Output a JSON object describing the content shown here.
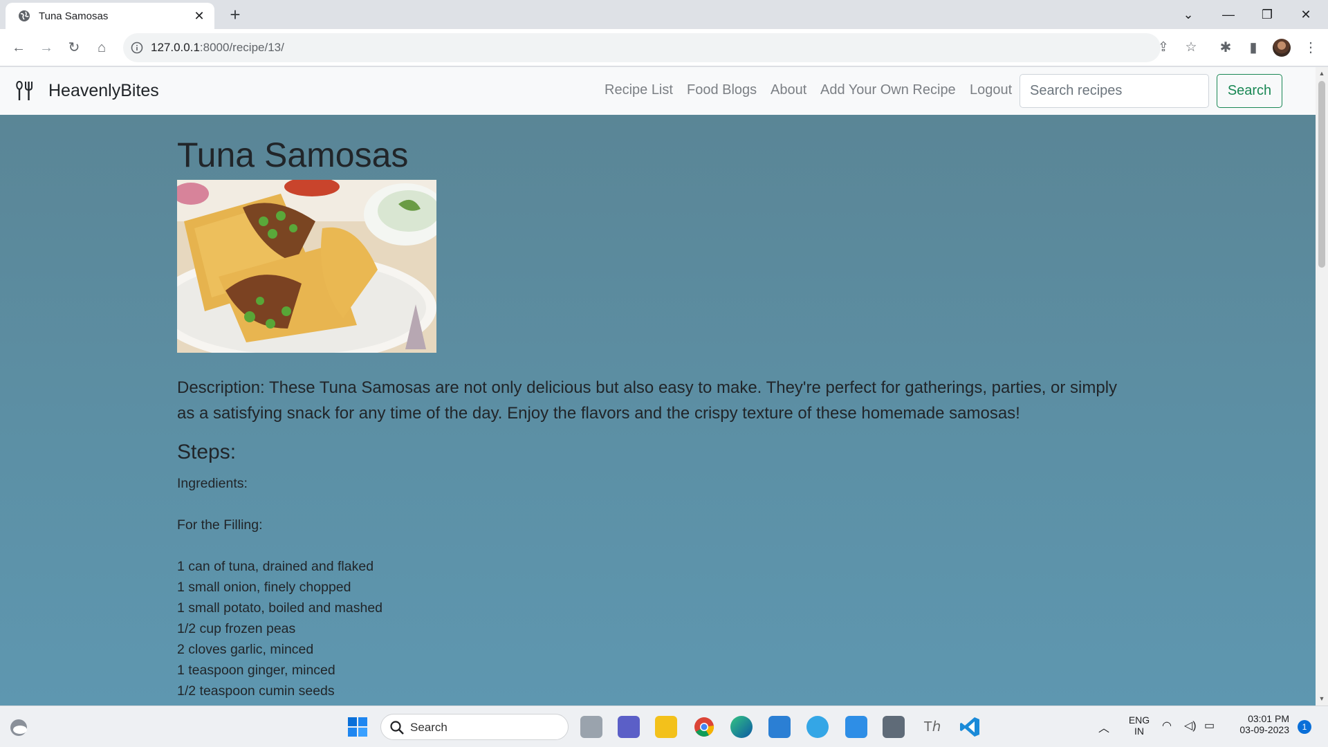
{
  "browser": {
    "tab_title": "Tuna Samosas",
    "url_host": "127.0.0.1",
    "url_rest": ":8000/recipe/13/"
  },
  "site": {
    "brand": "HeavenlyBites",
    "nav": [
      "Recipe List",
      "Food Blogs",
      "About",
      "Add Your Own Recipe",
      "Logout"
    ],
    "search_placeholder": "Search recipes",
    "search_button": "Search"
  },
  "recipe": {
    "title": "Tuna Samosas",
    "description": "Description: These Tuna Samosas are not only delicious but also easy to make. They're perfect for gatherings, parties, or simply as a satisfying snack for any time of the day. Enjoy the flavors and the crispy texture of these homemade samosas!",
    "steps_heading": "Steps:",
    "steps_text": "Ingredients:\n\nFor the Filling:\n\n1 can of tuna, drained and flaked\n1 small onion, finely chopped\n1 small potato, boiled and mashed\n1/2 cup frozen peas\n2 cloves garlic, minced\n1 teaspoon ginger, minced\n1/2 teaspoon cumin seeds"
  },
  "taskbar": {
    "search_label": "Search",
    "language_top": "ENG",
    "language_bottom": "IN",
    "time": "03:01 PM",
    "date": "03-09-2023",
    "notification_count": "1"
  }
}
